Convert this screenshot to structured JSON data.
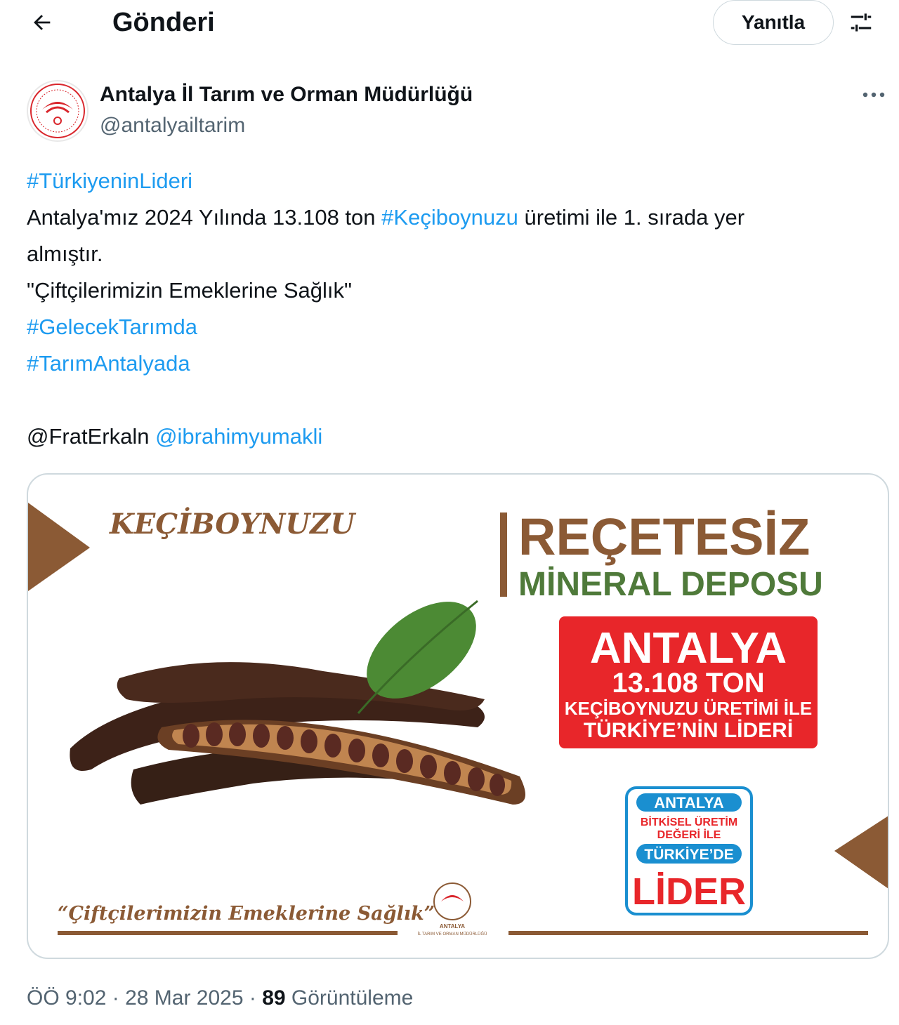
{
  "header": {
    "back_icon": "arrow-left-icon",
    "title": "Gönderi",
    "reply_label": "Yanıtla",
    "filter_icon": "sliders-icon"
  },
  "author": {
    "name": "Antalya İl Tarım ve Orman Müdürlüğü",
    "handle": "@antalyailtarim",
    "more_icon": "more-horizontal-icon"
  },
  "tweet": {
    "hashtag1": "#TürkiyeninLideri",
    "line2_prefix": "Antalya'mız 2024 Yılında 13.108 ton ",
    "hashtag2": "#Keçiboynuzu",
    "line2_suffix": " üretimi ile 1. sırada yer",
    "line3": "almıştır.",
    "line4": "\"Çiftçilerimizin Emeklerine Sağlık\"",
    "hashtag3": "#GelecekTarımda",
    "hashtag4": "#TarımAntalyada",
    "mention1": "@FratErkaln",
    "mention2": "@ibrahimyumakli"
  },
  "media": {
    "left_title": "KEÇİBOYNUZU",
    "headline": "REÇETESİZ",
    "subheadline": "MİNERAL DEPOSU",
    "box_city": "ANTALYA",
    "box_amount": "13.108 TON",
    "box_line1": "KEÇİBOYNUZU ÜRETİMİ İLE",
    "box_line2": "TÜRKİYE’NİN LİDERİ",
    "badge_top": "ANTALYA",
    "badge_mid1": "BİTKİSEL ÜRETİM",
    "badge_mid2": "DEĞERİ İLE",
    "badge_country": "TÜRKİYE’DE",
    "badge_bottom": "LİDER",
    "slogan": "“Çiftçilerimizin Emeklerine Sağlık”",
    "logo_line1": "ANTALYA",
    "logo_line2": "İL TARIM VE ORMAN MÜDÜRLÜĞÜ",
    "colors": {
      "brown": "#8b5a35",
      "green": "#4f7a3a",
      "red": "#e8262a",
      "blue": "#1a8fd0"
    }
  },
  "footer": {
    "time": "ÖÖ 9:02",
    "sep1": " · ",
    "date": "28 Mar 2025",
    "sep2": " · ",
    "views_count": "89",
    "views_label": " Görüntüleme"
  }
}
